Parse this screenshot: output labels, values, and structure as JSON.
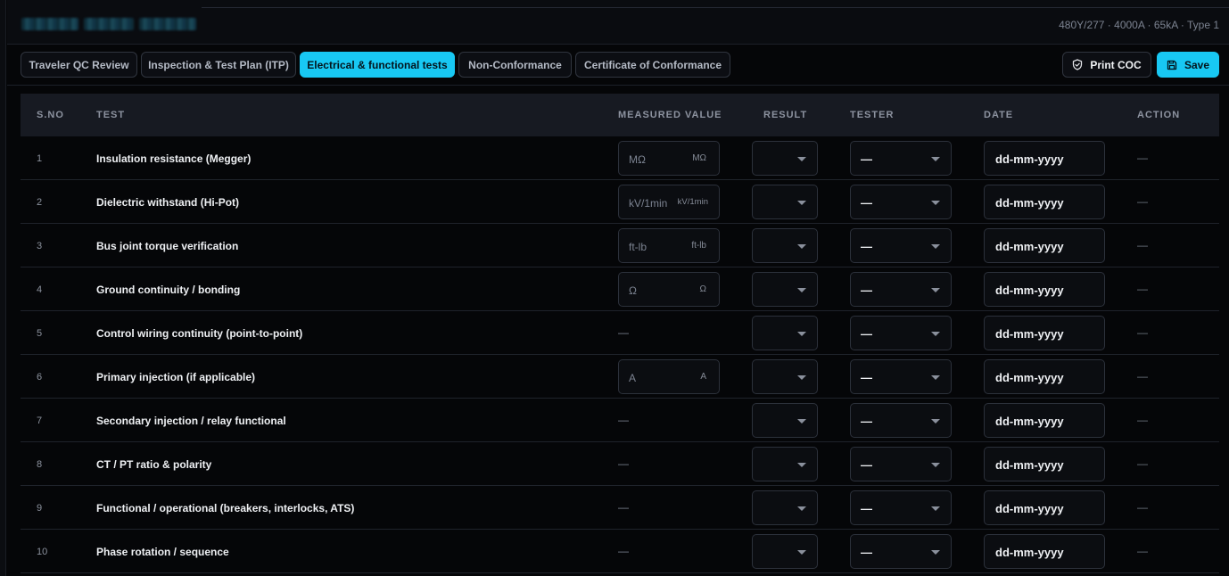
{
  "header": {
    "spec": "480Y/277 · 4000A · 65kA · Type 1"
  },
  "tabs": [
    {
      "label": "Traveler QC Review",
      "active": false
    },
    {
      "label": "Inspection & Test Plan (ITP)",
      "active": false
    },
    {
      "label": "Electrical & functional tests",
      "active": true
    },
    {
      "label": "Non-Conformance",
      "active": false
    },
    {
      "label": "Certificate of Conformance",
      "active": false
    }
  ],
  "actions": {
    "print_label": "Print COC",
    "print_icon": "shield-icon",
    "save_label": "Save",
    "save_icon": "floppy-disk-icon"
  },
  "colors": {
    "accent": "#18c8f3",
    "background": "#050608",
    "header_row": "#171a22"
  },
  "table": {
    "columns": [
      "S.NO",
      "TEST",
      "MEASURED VALUE",
      "RESULT",
      "TESTER",
      "DATE",
      "ACTION"
    ],
    "rows": [
      {
        "sno": "1",
        "test": "Insulation resistance (Megger)",
        "placeholder": "MΩ",
        "unit": "MΩ",
        "tester": "—",
        "date": "dd-mm-yyyy",
        "action": "—"
      },
      {
        "sno": "2",
        "test": "Dielectric withstand (Hi-Pot)",
        "placeholder": "kV/1min",
        "unit": "kV/1min",
        "tester": "—",
        "date": "dd-mm-yyyy",
        "action": "—"
      },
      {
        "sno": "3",
        "test": "Bus joint torque verification",
        "placeholder": "ft-lb",
        "unit": "ft-lb",
        "tester": "—",
        "date": "dd-mm-yyyy",
        "action": "—"
      },
      {
        "sno": "4",
        "test": "Ground continuity / bonding",
        "placeholder": "Ω",
        "unit": "Ω",
        "tester": "—",
        "date": "dd-mm-yyyy",
        "action": "—"
      },
      {
        "sno": "5",
        "test": "Control wiring continuity (point-to-point)",
        "measured": "—",
        "tester": "—",
        "date": "dd-mm-yyyy",
        "action": "—"
      },
      {
        "sno": "6",
        "test": "Primary injection (if applicable)",
        "placeholder": "A",
        "unit": "A",
        "tester": "—",
        "date": "dd-mm-yyyy",
        "action": "—"
      },
      {
        "sno": "7",
        "test": "Secondary injection / relay functional",
        "measured": "—",
        "tester": "—",
        "date": "dd-mm-yyyy",
        "action": "—"
      },
      {
        "sno": "8",
        "test": "CT / PT ratio & polarity",
        "measured": "—",
        "tester": "—",
        "date": "dd-mm-yyyy",
        "action": "—"
      },
      {
        "sno": "9",
        "test": "Functional / operational (breakers, interlocks, ATS)",
        "measured": "—",
        "tester": "—",
        "date": "dd-mm-yyyy",
        "action": "—"
      },
      {
        "sno": "10",
        "test": "Phase rotation / sequence",
        "measured": "—",
        "tester": "—",
        "date": "dd-mm-yyyy",
        "action": "—"
      }
    ]
  }
}
